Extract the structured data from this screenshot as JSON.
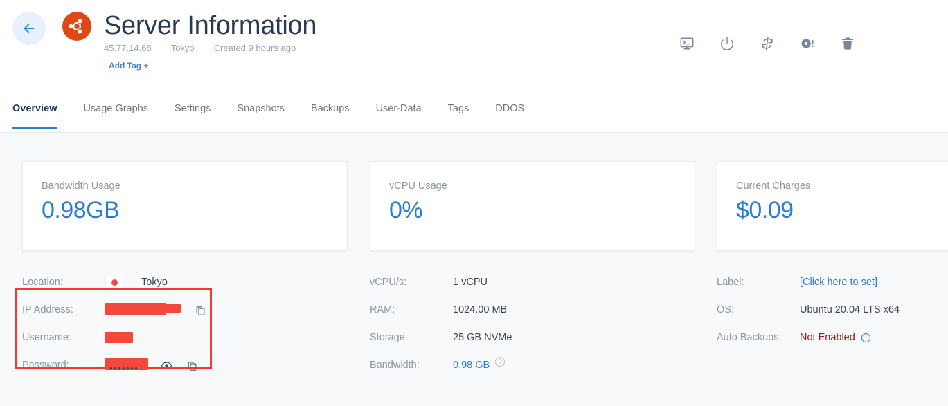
{
  "header": {
    "back_icon": "arrow-left-icon",
    "os_logo_icon": "ubuntu-logo-icon",
    "title": "Server Information",
    "meta": [
      {
        "text": "45.77.14.68"
      },
      {
        "text": "Tokyo"
      },
      {
        "text": "Created 9 hours ago"
      }
    ],
    "add_tag_label": "Add Tag +",
    "actions": [
      {
        "name": "console-icon",
        "title": "Console"
      },
      {
        "name": "power-icon",
        "title": "Power"
      },
      {
        "name": "restart-icon",
        "title": "Restart"
      },
      {
        "name": "reinstall-icon",
        "title": "Reinstall"
      },
      {
        "name": "delete-icon",
        "title": "Destroy"
      }
    ]
  },
  "tabs": [
    {
      "label": "Overview",
      "active": true
    },
    {
      "label": "Usage Graphs",
      "active": false
    },
    {
      "label": "Settings",
      "active": false
    },
    {
      "label": "Snapshots",
      "active": false
    },
    {
      "label": "Backups",
      "active": false
    },
    {
      "label": "User-Data",
      "active": false
    },
    {
      "label": "Tags",
      "active": false
    },
    {
      "label": "DDOS",
      "active": false
    }
  ],
  "cards": [
    {
      "label": "Bandwidth Usage",
      "value": "0.98GB"
    },
    {
      "label": "vCPU Usage",
      "value": "0%"
    },
    {
      "label": "Current Charges",
      "value": "$0.09"
    }
  ],
  "details": {
    "col1": {
      "location_label": "Location:",
      "location_value": "Tokyo",
      "location_flag_icon": "japan-flag-icon",
      "ip_label": "IP Address:",
      "ip_value": "",
      "ip_copy_icon": "copy-icon",
      "username_label": "Username:",
      "username_value": "",
      "password_label": "Password:",
      "password_masked": "•••••••",
      "password_eye_icon": "eye-icon",
      "password_copy_icon": "copy-icon"
    },
    "col2": [
      {
        "label": "vCPU/s:",
        "value": "1 vCPU"
      },
      {
        "label": "RAM:",
        "value": "1024.00 MB"
      },
      {
        "label": "Storage:",
        "value": "25 GB NVMe"
      },
      {
        "label": "Bandwidth:",
        "value": "0.98 GB",
        "link": true,
        "help_icon": "question-mark-icon",
        "help_glyph": "?"
      }
    ],
    "col3": [
      {
        "label": "Label:",
        "value": "[Click here to set]",
        "link": true
      },
      {
        "label": "OS:",
        "value": "Ubuntu 20.04 LTS x64"
      },
      {
        "label": "Auto Backups:",
        "value": "Not Enabled",
        "warn": true,
        "info_icon": "info-circle-icon"
      }
    ]
  },
  "colors": {
    "accent_blue": "#2b7dd4",
    "ubuntu_orange": "#dd4814",
    "redaction_red": "#f6473d",
    "highlight_border": "#f6382f",
    "warn_red": "#a31515",
    "muted_text": "#8d959d"
  }
}
